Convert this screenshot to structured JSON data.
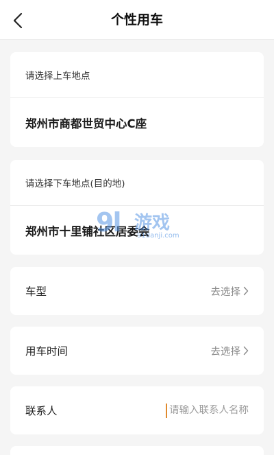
{
  "header": {
    "title": "个性用车",
    "back_icon": "chevron-left-icon"
  },
  "pickup": {
    "hint": "请选择上车地点",
    "value": "郑州市商都世贸中心C座"
  },
  "dropoff": {
    "hint": "请选择下车地点(目的地)",
    "value": "郑州市十里铺社区居委会"
  },
  "car_type": {
    "label": "车型",
    "value": "去选择"
  },
  "time": {
    "label": "用车时间",
    "value": "去选择"
  },
  "contact": {
    "label": "联系人",
    "placeholder": "请输入联系人名称",
    "value": ""
  },
  "watermark": {
    "logo": "9l",
    "text": "游戏",
    "url": "91danji.com"
  },
  "colors": {
    "background": "#f5f5f5",
    "card": "#ffffff",
    "caret": "#e08a2e",
    "muted_text": "#8a8a8a"
  }
}
